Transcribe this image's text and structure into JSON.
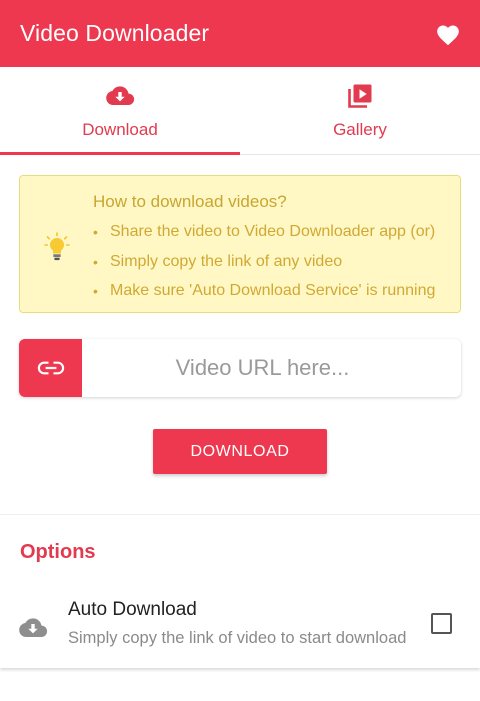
{
  "appbar": {
    "title": "Video Downloader",
    "favorite_icon": "heart-icon"
  },
  "tabs": [
    {
      "label": "Download",
      "icon": "cloud-download-icon",
      "active": true
    },
    {
      "label": "Gallery",
      "icon": "video-library-icon",
      "active": false
    }
  ],
  "tips": {
    "title": "How to download videos?",
    "icon": "lightbulb-icon",
    "items": [
      "Share the video to Video Downloader app (or)",
      "Simply copy the link of any video",
      "Make sure 'Auto Download Service' is running"
    ]
  },
  "url_input": {
    "value": "",
    "placeholder": "Video URL here...",
    "icon": "link-icon"
  },
  "download_button": {
    "label": "DOWNLOAD"
  },
  "options": {
    "title": "Options",
    "items": [
      {
        "title": "Auto Download",
        "subtitle": "Simply copy the link of video to start download",
        "icon": "cloud-download-icon",
        "checked": false
      }
    ]
  },
  "colors": {
    "primary": "#ee384f",
    "tip_bg": "#fff8c4",
    "tip_text": "#d1a834",
    "tip_border": "#e6de7a"
  }
}
